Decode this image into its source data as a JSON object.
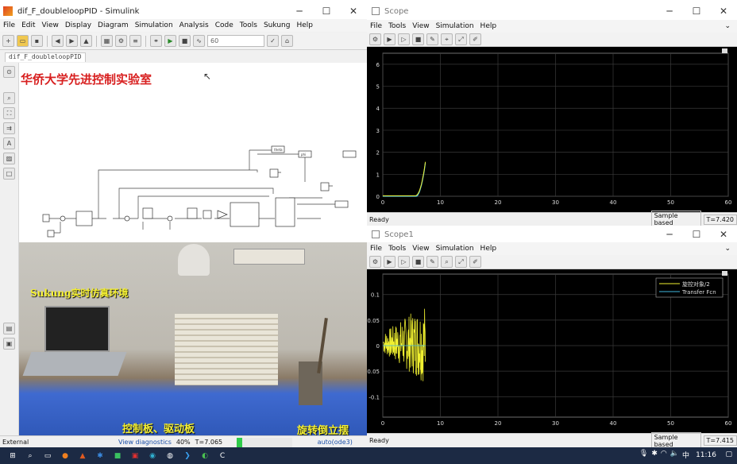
{
  "simulink": {
    "title": "dif_F_doubleloopPID - Simulink",
    "menu": [
      "File",
      "Edit",
      "View",
      "Display",
      "Diagram",
      "Simulation",
      "Analysis",
      "Code",
      "Tools",
      "Sukung",
      "Help"
    ],
    "stop_time": "60",
    "tab": "dif_F_doubleloopPID",
    "lab_title": "华侨大学先进控制实验室",
    "status": {
      "mode": "External",
      "diag": "View diagnostics",
      "zoom": "40%",
      "time": "T=7.065",
      "progress": "11%",
      "solver": "auto(ode3)"
    },
    "block_labels": [
      "theta",
      "phi"
    ]
  },
  "photo": {
    "label_top": "Sukung实时仿真环境",
    "label_bottom_left": "控制板、驱动板",
    "label_bottom_right": "旋转倒立摆"
  },
  "scope1": {
    "title": "Scope",
    "menu": [
      "File",
      "Tools",
      "View",
      "Simulation",
      "Help"
    ],
    "status_left": "Ready",
    "sample": "Sample based",
    "time": "T=7.420",
    "yticks": [
      "6",
      "5",
      "4",
      "3",
      "2",
      "1",
      "0"
    ],
    "xticks": [
      "0",
      "10",
      "20",
      "30",
      "40",
      "50",
      "60"
    ]
  },
  "scope2": {
    "title": "Scope1",
    "menu": [
      "File",
      "Tools",
      "View",
      "Simulation",
      "Help"
    ],
    "status_left": "Ready",
    "sample": "Sample based",
    "time": "T=7.415",
    "yticks": [
      "0.1",
      "0.05",
      "0",
      "-0.05",
      "-0.1"
    ],
    "xticks": [
      "0",
      "10",
      "20",
      "30",
      "40",
      "50",
      "60"
    ],
    "legend": [
      "旋控对象/2",
      "Transfer Fcn"
    ]
  },
  "taskbar": {
    "lang": "中",
    "time": "11:16"
  },
  "colors": {
    "yellow": "#f0f030",
    "cyan": "#3fb8e0",
    "lab_red": "#d82020"
  }
}
